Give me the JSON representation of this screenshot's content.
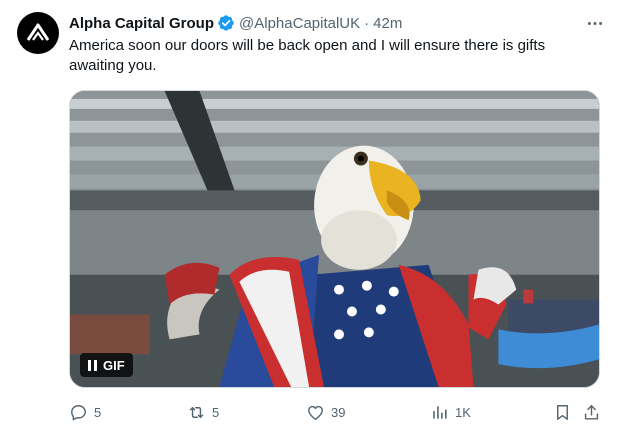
{
  "author": {
    "display_name": "Alpha Capital Group",
    "handle": "@AlphaCapitalUK",
    "separator": "·",
    "time": "42m",
    "verified_color": "#1d9bf0",
    "avatar_icon": "alpha-logo-icon"
  },
  "tweet": {
    "text": "America soon our doors will be back open and I will ensure there is gifts awaiting you."
  },
  "media": {
    "type": "gif",
    "badge_label": "GIF",
    "controls_icon": "pause-icon"
  },
  "actions": {
    "replies": "5",
    "retweets": "5",
    "likes": "39",
    "views": "1K"
  },
  "colors": {
    "text_primary": "#0f1419",
    "text_secondary": "#536471",
    "accent": "#1d9bf0"
  }
}
